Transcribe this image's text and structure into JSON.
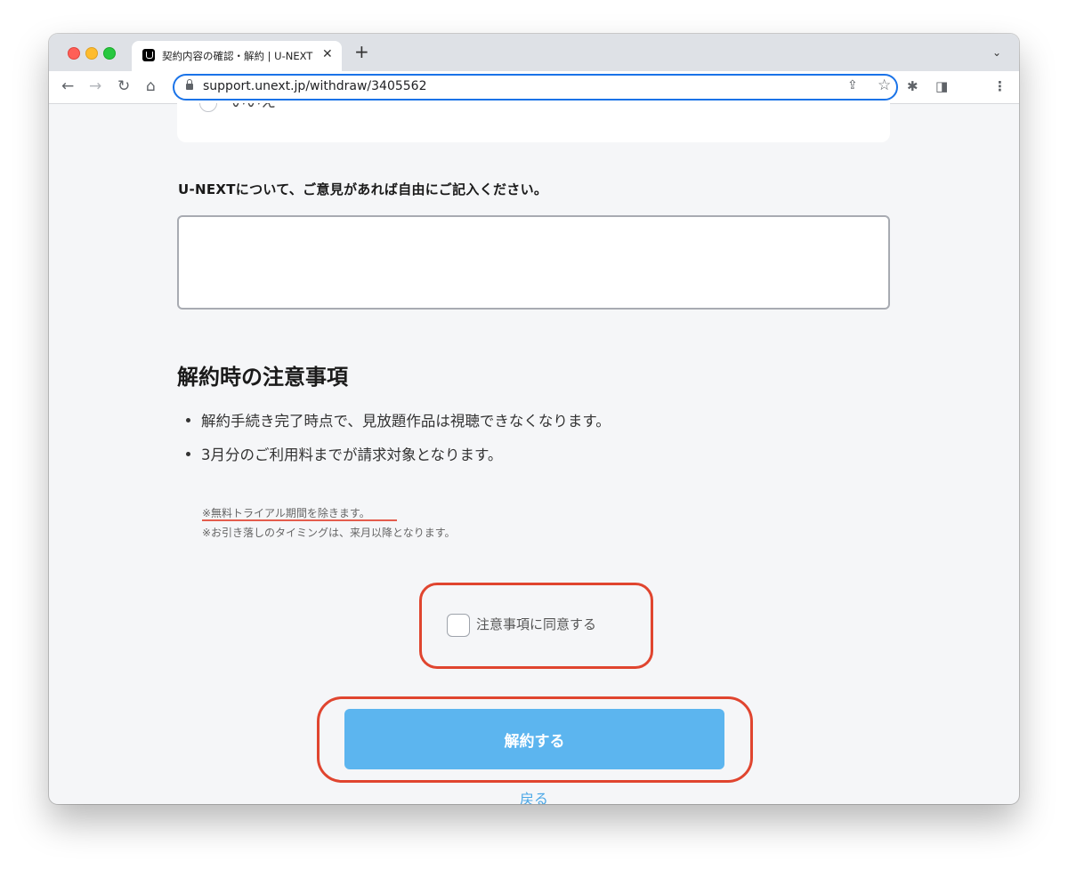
{
  "browser": {
    "tab_title": "契約内容の確認・解約 | U-NEXT",
    "tab_close": "✕",
    "new_tab": "+",
    "tab_menu": "⌄",
    "url": "support.unext.jp/withdraw/3405562",
    "nav": {
      "back": "←",
      "forward": "→",
      "reload": "↻",
      "home": "⌂"
    },
    "icons": {
      "share": "⇪",
      "star": "☆",
      "extensions": "✱",
      "sidepanel": "◨",
      "menu": "⋮"
    }
  },
  "form": {
    "partial_radio_label": "いいえ",
    "feedback_label": "U-NEXTについて、ご意見があれば自由にご記入ください。",
    "feedback_value": ""
  },
  "notes": {
    "title": "解約時の注意事項",
    "items": [
      "解約手続き完了時点で、見放題作品は視聴できなくなります。",
      "3月分のご利用料までが請求対象となります。"
    ],
    "subnotes": [
      "※無料トライアル期間を除きます。",
      "※お引き落しのタイミングは、来月以降となります。"
    ]
  },
  "agree": {
    "label": "注意事項に同意する",
    "checked": false
  },
  "actions": {
    "submit_label": "解約する",
    "back_label": "戻る"
  },
  "colors": {
    "submit_button": "#5cb5ef",
    "highlight": "#e0452f",
    "link": "#4aa7e6",
    "omnibox_focus": "#1a73e8"
  }
}
